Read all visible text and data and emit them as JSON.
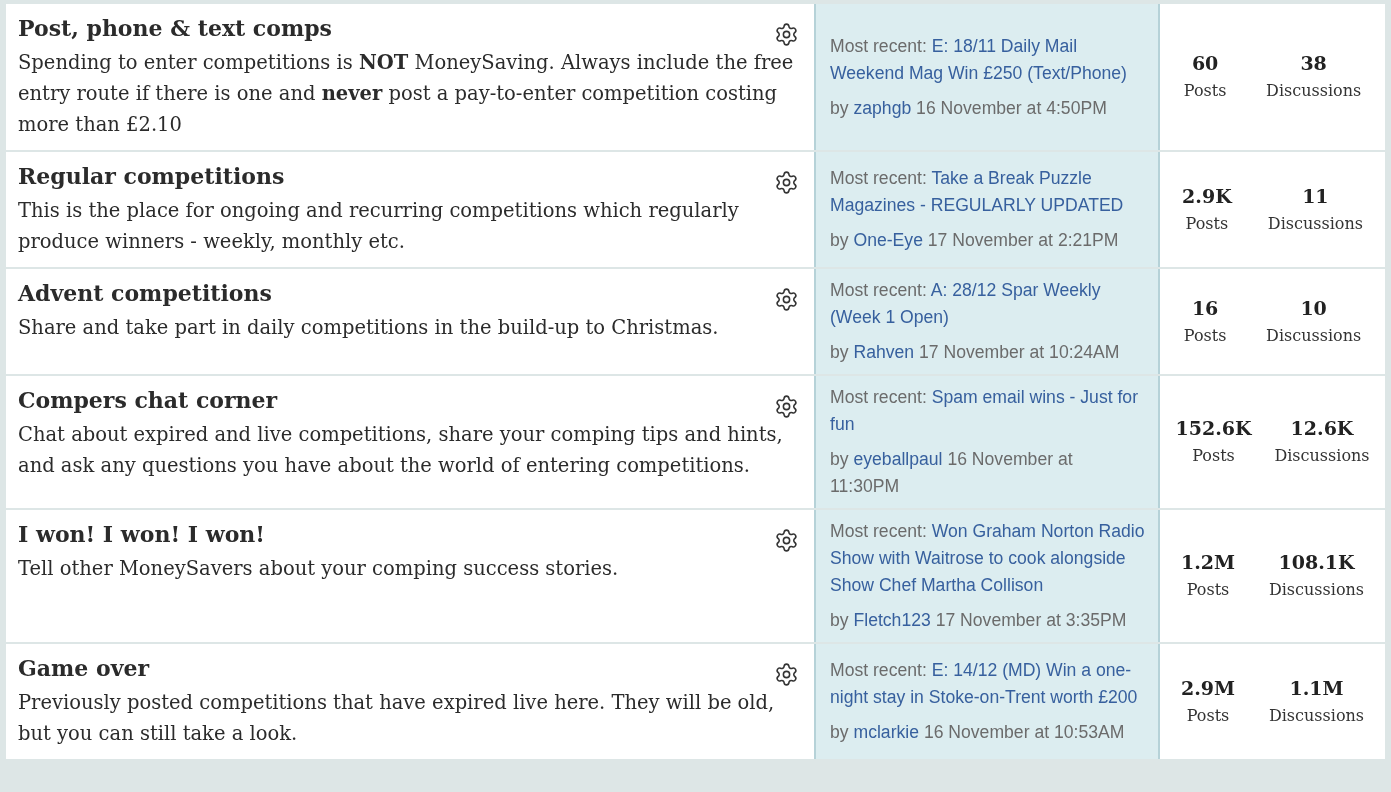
{
  "categories": [
    {
      "title": "Post, phone & text comps",
      "description": "Spending to enter competitions is **NOT** MoneySaving. Always include the free entry route if there is one and **never** post a pay-to-enter competition costing more than £2.10",
      "recent": {
        "label": "Most recent:",
        "thread": "E: 18/11 Daily Mail Weekend Mag Win £250 (Text/Phone)",
        "by": "by",
        "author": "zaphgb",
        "date": "16 November at 4:50PM"
      },
      "posts": "60",
      "posts_label": "Posts",
      "discussions": "38",
      "discussions_label": "Discussions"
    },
    {
      "title": "Regular competitions",
      "description": "This is the place for ongoing and recurring competitions which regularly produce winners - weekly, monthly etc.",
      "recent": {
        "label": "Most recent:",
        "thread": "Take a Break Puzzle Magazines - REGULARLY UPDATED",
        "by": "by",
        "author": "One-Eye",
        "date": "17 November at 2:21PM"
      },
      "posts": "2.9K",
      "posts_label": "Posts",
      "discussions": "11",
      "discussions_label": "Discussions"
    },
    {
      "title": "Advent competitions",
      "description": "Share and take part in daily competitions in the build-up to Christmas.",
      "recent": {
        "label": "Most recent:",
        "thread": "A: 28/12 Spar Weekly (Week 1 Open)",
        "by": "by",
        "author": "Rahven",
        "date": "17 November at 10:24AM"
      },
      "posts": "16",
      "posts_label": "Posts",
      "discussions": "10",
      "discussions_label": "Discussions"
    },
    {
      "title": "Compers chat corner",
      "description": "Chat about expired and live competitions, share your comping tips and hints, and ask any questions you have about the world of entering competitions.",
      "recent": {
        "label": "Most recent:",
        "thread": "Spam email wins - Just for fun",
        "by": "by",
        "author": "eyeballpaul",
        "date": "16 November at 11:30PM"
      },
      "posts": "152.6K",
      "posts_label": "Posts",
      "discussions": "12.6K",
      "discussions_label": "Discussions"
    },
    {
      "title": "I won! I won! I won!",
      "description": "Tell other MoneySavers about your comping success stories.",
      "recent": {
        "label": "Most recent:",
        "thread": "Won Graham Norton Radio Show with Waitrose to cook alongside Show Chef Martha Collison",
        "by": "by",
        "author": "Fletch123",
        "date": "17 November at 3:35PM"
      },
      "posts": "1.2M",
      "posts_label": "Posts",
      "discussions": "108.1K",
      "discussions_label": "Discussions"
    },
    {
      "title": "Game over",
      "description": "Previously posted competitions that have expired live here. They will be old, but you can still take a look.",
      "recent": {
        "label": "Most recent:",
        "thread": "E: 14/12 (MD) Win a one-night stay in Stoke-on-Trent worth £200",
        "by": "by",
        "author": "mclarkie",
        "date": "16 November at 10:53AM"
      },
      "posts": "2.9M",
      "posts_label": "Posts",
      "discussions": "1.1M",
      "discussions_label": "Discussions"
    }
  ]
}
